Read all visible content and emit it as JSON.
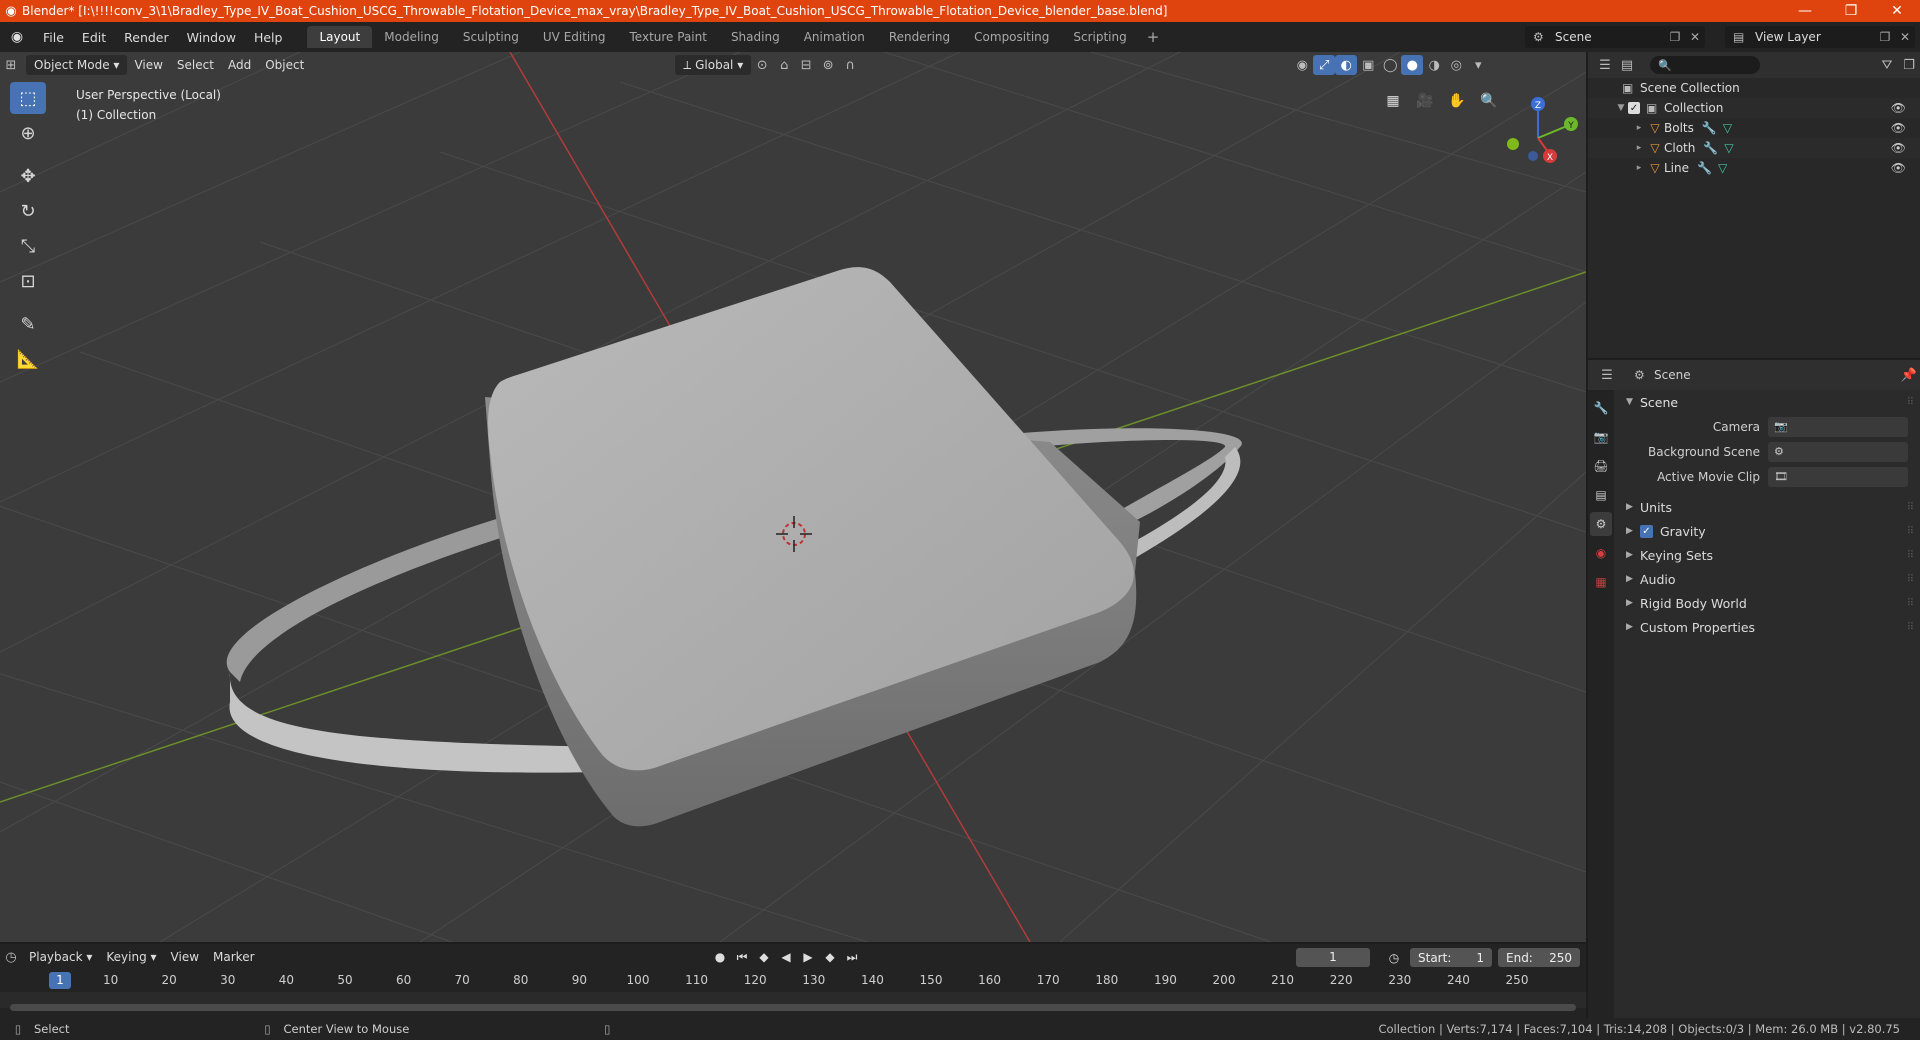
{
  "window": {
    "title": "Blender* [I:\\!!!!conv_3\\1\\Bradley_Type_IV_Boat_Cushion_USCG_Throwable_Flotation_Device_max_vray\\Bradley_Type_IV_Boat_Cushion_USCG_Throwable_Flotation_Device_blender_base.blend]",
    "controls": [
      "—",
      "❐",
      "✕"
    ]
  },
  "menu": [
    "File",
    "Edit",
    "Render",
    "Window",
    "Help"
  ],
  "workspaces": [
    "Layout",
    "Modeling",
    "Sculpting",
    "UV Editing",
    "Texture Paint",
    "Shading",
    "Animation",
    "Rendering",
    "Compositing",
    "Scripting"
  ],
  "workspace_add": "+",
  "scene_selector": "Scene",
  "view_layer_selector": "View Layer",
  "viewport": {
    "mode": "Object Mode",
    "menus": [
      "View",
      "Select",
      "Add",
      "Object"
    ],
    "transform_orientation": "Global",
    "info_line1": "User Perspective (Local)",
    "info_line2": "(1) Collection",
    "gizmo_axes": [
      "Z",
      "Y",
      "X"
    ]
  },
  "outliner": {
    "root": "Scene Collection",
    "collection": "Collection",
    "objects": [
      "Bolts",
      "Cloth",
      "Line"
    ]
  },
  "properties": {
    "header": "Scene",
    "panel": "Scene",
    "fields": [
      {
        "label": "Camera",
        "value": ""
      },
      {
        "label": "Background Scene",
        "value": ""
      },
      {
        "label": "Active Movie Clip",
        "value": ""
      }
    ],
    "subpanels": [
      "Units",
      "Gravity",
      "Keying Sets",
      "Audio",
      "Rigid Body World",
      "Custom Properties"
    ],
    "gravity_checked": true
  },
  "timeline": {
    "menus": [
      "Playback",
      "Keying",
      "View",
      "Marker"
    ],
    "current_frame": "1",
    "start_label": "Start:",
    "start": "1",
    "end_label": "End:",
    "end": "250",
    "ruler": [
      "10",
      "20",
      "30",
      "40",
      "50",
      "60",
      "70",
      "80",
      "90",
      "100",
      "110",
      "120",
      "130",
      "140",
      "150",
      "160",
      "170",
      "180",
      "190",
      "200",
      "210",
      "220",
      "230",
      "240",
      "250"
    ],
    "ruler_current": "1"
  },
  "statusbar": {
    "left1": "Select",
    "left2": "Center View to Mouse",
    "right": "Collection | Verts:7,174 | Faces:7,104 | Tris:14,208 | Objects:0/3 | Mem: 26.0 MB | v2.80.75"
  }
}
